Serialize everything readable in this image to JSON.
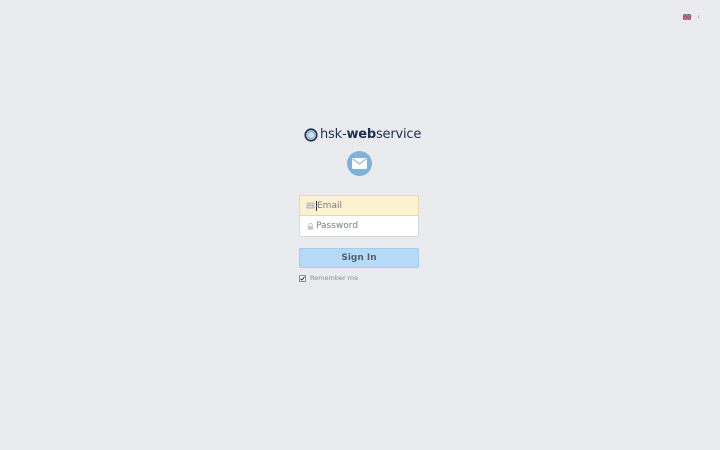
{
  "language": {
    "current": "English (UK)",
    "flag_icon": "uk-flag-icon",
    "chevron_icon": "chevron-left-icon"
  },
  "logo": {
    "prefix": "hsk-",
    "bold": "web",
    "suffix": "service"
  },
  "login": {
    "mail_icon": "envelope-icon",
    "email_placeholder": "Email",
    "email_value": "",
    "password_placeholder": "Password",
    "password_value": "",
    "submit_label": "Sign In",
    "remember_label": "Remember me",
    "remember_checked": true
  },
  "colors": {
    "background": "#e9ebee",
    "logo_text": "#1f2f4f",
    "mail_circle": "#7fb1d9",
    "email_field_bg": "#fdf2cf",
    "button_bg": "#b5dbf7",
    "button_text": "#55606e"
  }
}
